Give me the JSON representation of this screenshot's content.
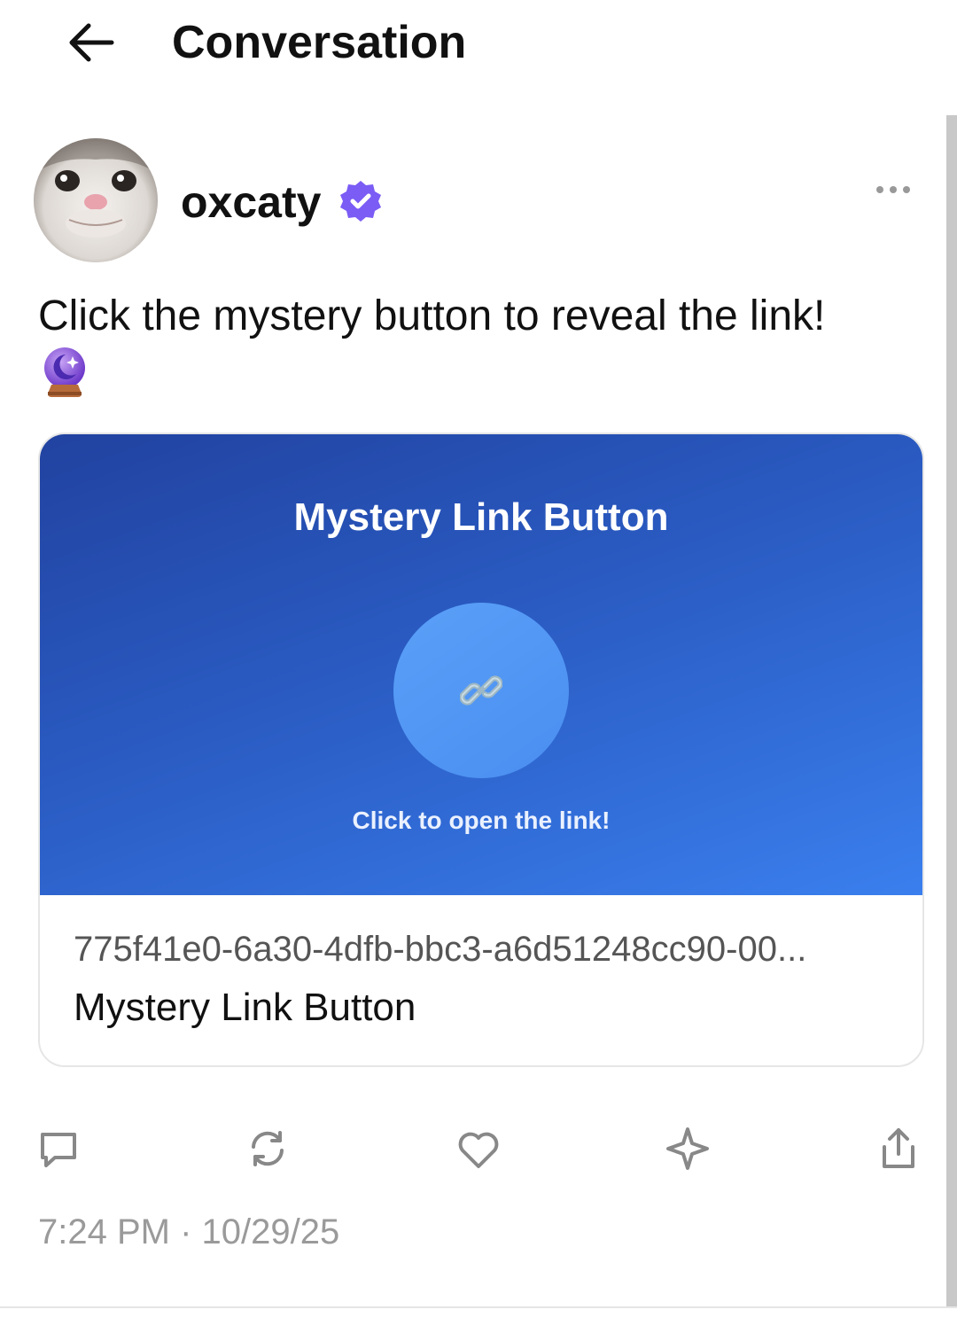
{
  "header": {
    "title": "Conversation"
  },
  "post": {
    "author": "oxcaty",
    "text": "Click the mystery button to reveal the link!",
    "emoji": "crystal-ball",
    "timestamp": "7:24 PM · 10/29/25"
  },
  "link_card": {
    "hero_title": "Mystery Link Button",
    "hero_caption": "Click to open the link!",
    "url": "775f41e0-6a30-4dfb-bbc3-a6d51248cc90-00...",
    "title": "Mystery Link Button"
  },
  "icons": {
    "back": "arrow-left-icon",
    "verified": "verified-badge-icon",
    "more": "more-horizontal-icon",
    "link": "link-icon",
    "reply": "reply-icon",
    "repost": "repost-icon",
    "like": "heart-icon",
    "save": "sparkle-icon",
    "share": "share-icon"
  },
  "colors": {
    "verified": "#7b5cf5",
    "hero_start": "#2142a0",
    "hero_end": "#3a7fee",
    "muted_text": "#9a9a9a"
  }
}
